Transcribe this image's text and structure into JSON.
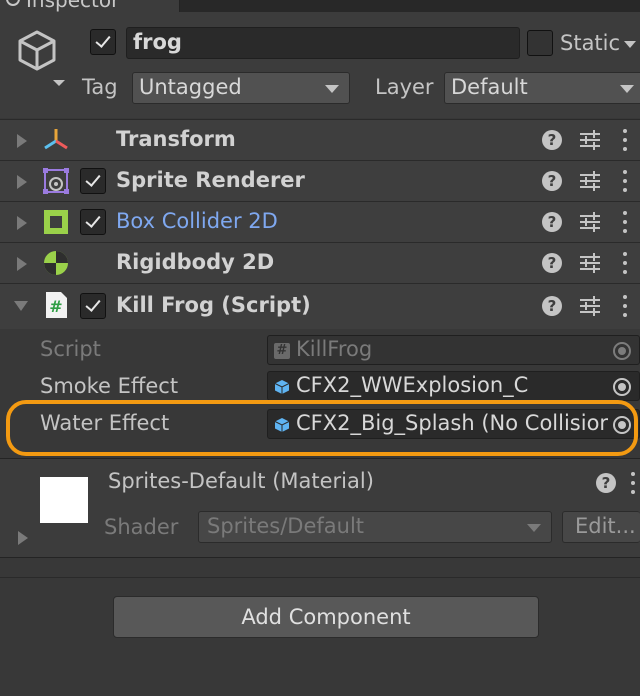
{
  "tab": {
    "label": "Inspector"
  },
  "gameobject": {
    "active": true,
    "name": "frog",
    "static_label": "Static",
    "static_checked": false,
    "tag_label": "Tag",
    "tag_value": "Untagged",
    "layer_label": "Layer",
    "layer_value": "Default"
  },
  "components": [
    {
      "name": "Transform",
      "icon": "transform-icon",
      "has_checkbox": false,
      "expanded": false
    },
    {
      "name": "Sprite Renderer",
      "icon": "sprite-renderer-icon",
      "has_checkbox": true,
      "enabled": true,
      "expanded": false
    },
    {
      "name": "Box Collider 2D",
      "icon": "box-collider-icon",
      "has_checkbox": true,
      "enabled": true,
      "expanded": false,
      "highlighted": true
    },
    {
      "name": "Rigidbody 2D",
      "icon": "rigidbody-icon",
      "has_checkbox": false,
      "expanded": false
    },
    {
      "name": "Kill Frog (Script)",
      "icon": "script-icon",
      "has_checkbox": true,
      "enabled": true,
      "expanded": true
    }
  ],
  "script_props": {
    "script_label": "Script",
    "script_value": "KillFrog",
    "smoke_label": "Smoke Effect",
    "smoke_value": "CFX2_WWExplosion_C",
    "water_label": "Water Effect",
    "water_value": "CFX2_Big_Splash (No Collisior"
  },
  "material": {
    "name": "Sprites-Default (Material)",
    "shader_label": "Shader",
    "shader_value": "Sprites/Default",
    "edit_label": "Edit..."
  },
  "add_component_label": "Add Component",
  "colors": {
    "highlight_ring": "#f39a12",
    "link_blue": "#7fa8f0",
    "cube_blue": "#5fb4f2"
  }
}
